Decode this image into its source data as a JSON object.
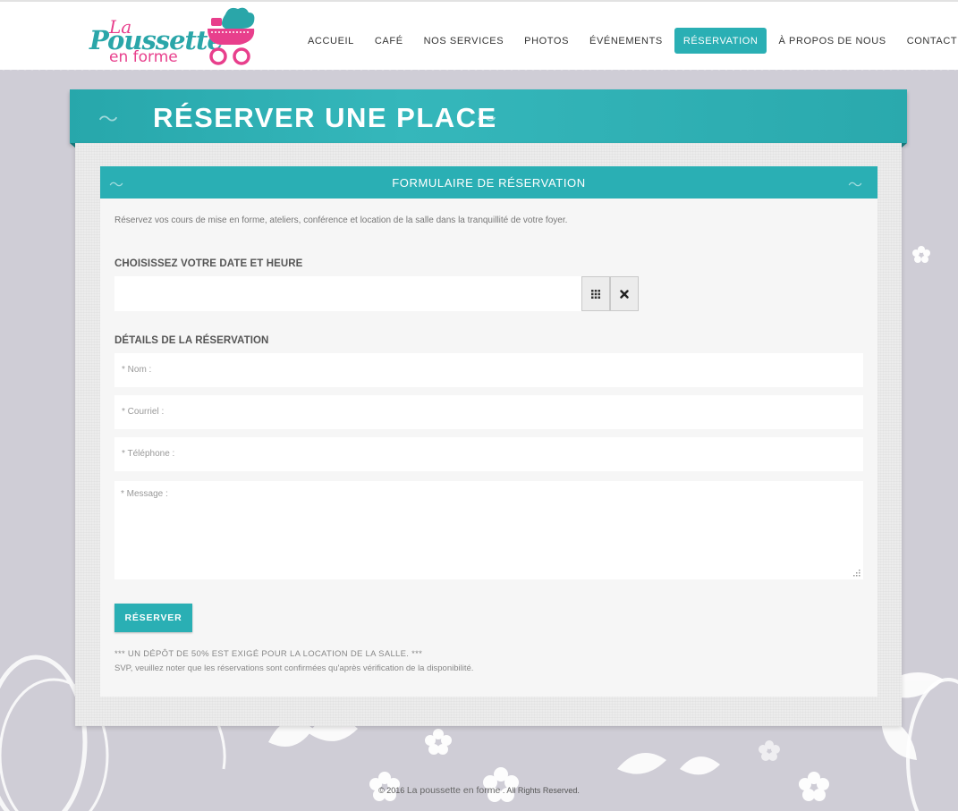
{
  "brand": {
    "logo_la": "La",
    "logo_poussette": "Poussette",
    "logo_enforme": "en forme",
    "colors": {
      "teal": "#2aafb4",
      "pink": "#e83f8c",
      "background": "#cfcdd6"
    }
  },
  "nav": {
    "items": [
      {
        "label": "ACCUEIL",
        "active": false
      },
      {
        "label": "CAFÉ",
        "active": false
      },
      {
        "label": "NOS SERVICES",
        "active": false
      },
      {
        "label": "PHOTOS",
        "active": false
      },
      {
        "label": "ÉVÉNEMENTS",
        "active": false
      },
      {
        "label": "RÉSERVATION",
        "active": true
      },
      {
        "label": "À PROPOS DE NOUS",
        "active": false
      },
      {
        "label": "CONTACT",
        "active": false
      }
    ]
  },
  "page": {
    "title": "RÉSERVER UNE PLACE"
  },
  "form": {
    "header": "FORMULAIRE DE RÉSERVATION",
    "intro": "Réservez vos cours de mise en forme, ateliers, conférence et location de la salle dans la tranquillité de votre foyer.",
    "date_section_label": "CHOISISSEZ VOTRE DATE ET HEURE",
    "date_value": "",
    "calendar_icon": "grid-calendar-icon",
    "clear_icon": "close-icon",
    "details_section_label": "DÉTAILS DE LA RÉSERVATION",
    "fields": {
      "name_placeholder": "* Nom :",
      "email_placeholder": "* Courriel :",
      "phone_placeholder": "* Téléphone :",
      "message_placeholder": "* Message :"
    },
    "submit_label": "RÉSERVER",
    "note_deposit": "*** UN DÉPÔT DE 50% EST EXIGÉ POUR LA LOCATION DE LA SALLE. ***",
    "note_confirmation": "SVP, veuillez noter que les réservations sont confirmées qu'après vérification de la disponibilité."
  },
  "footer": {
    "prefix": "© 2016",
    "brand": "La poussette en forme",
    "suffix": ". All Rights Reserved."
  }
}
